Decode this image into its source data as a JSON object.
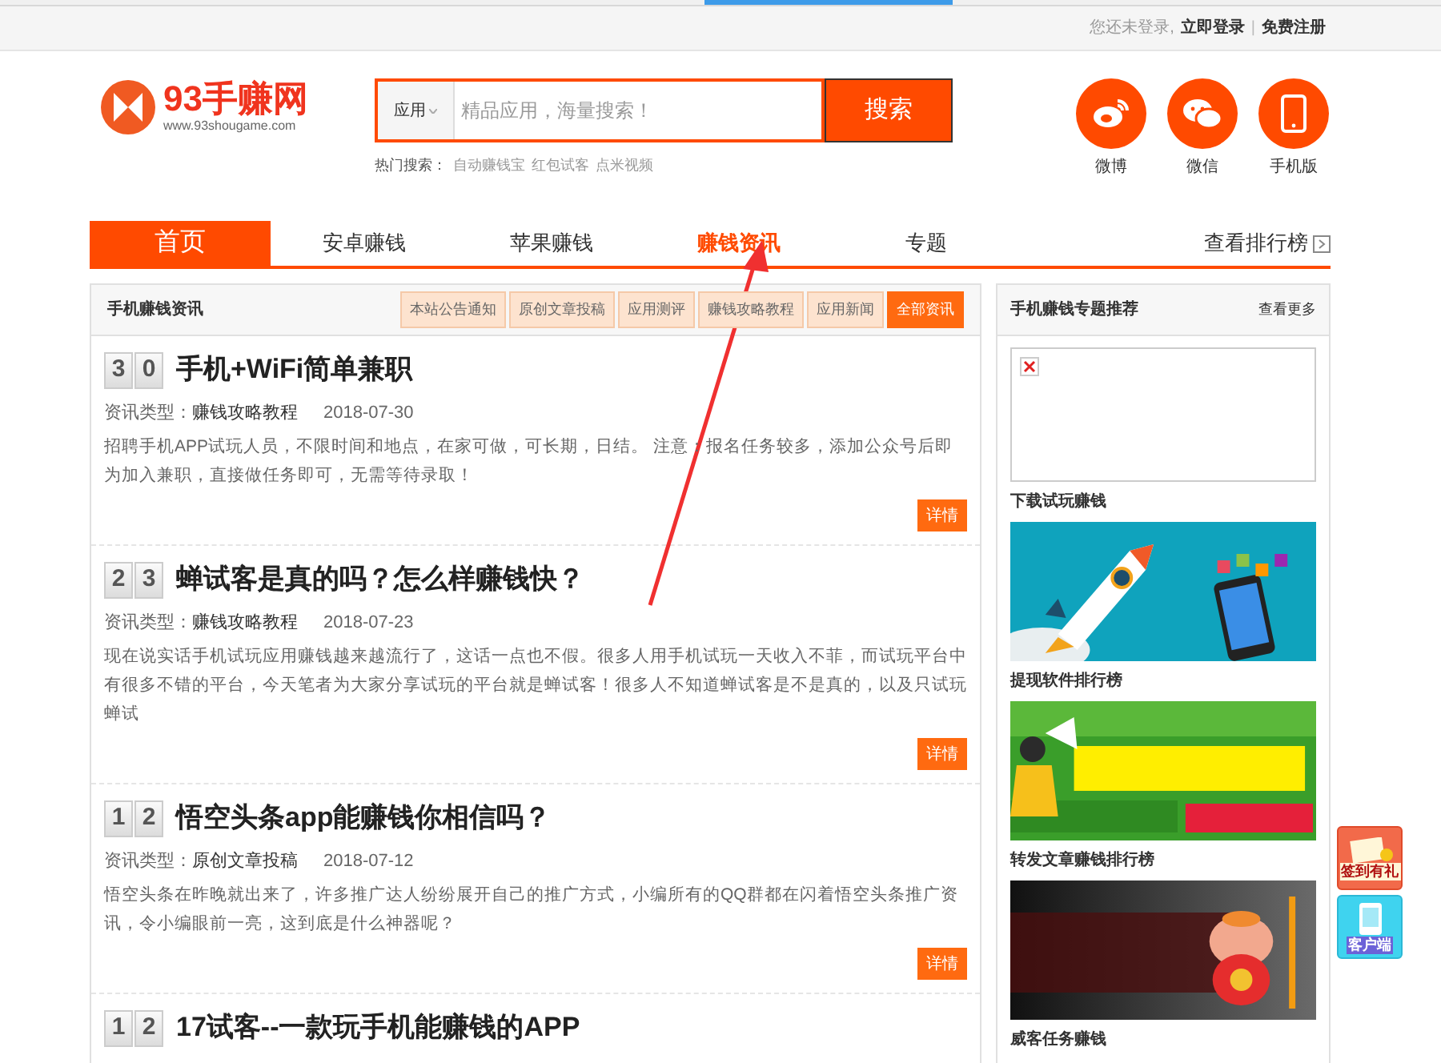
{
  "top_bar": {
    "notice": "您还未登录,",
    "login": "立即登录",
    "separator": "|",
    "register": "免费注册"
  },
  "logo": {
    "name": "93手赚网",
    "url": "www.93shougame.com"
  },
  "search": {
    "category": "应用",
    "placeholder": "精品应用，海量搜索！",
    "button": "搜索"
  },
  "hot_searches": {
    "label": "热门搜索：",
    "items": [
      "自动赚钱宝",
      "红包试客",
      "点米视频"
    ]
  },
  "social": [
    {
      "kind": "weibo",
      "label": "微博"
    },
    {
      "kind": "wechat",
      "label": "微信"
    },
    {
      "kind": "phone",
      "label": "手机版"
    }
  ],
  "nav": {
    "items": [
      {
        "label": "首页",
        "kind": "home",
        "selected": false
      },
      {
        "label": "安卓赚钱",
        "kind": "link",
        "selected": false
      },
      {
        "label": "苹果赚钱",
        "kind": "link",
        "selected": false
      },
      {
        "label": "赚钱资讯",
        "kind": "link",
        "selected": true
      },
      {
        "label": "专题",
        "kind": "link",
        "selected": false
      }
    ],
    "ranking": "查看排行榜"
  },
  "news": {
    "title": "手机赚钱资讯",
    "filters": [
      {
        "label": "本站公告通知",
        "selected": false
      },
      {
        "label": "原创文章投稿",
        "selected": false
      },
      {
        "label": "应用测评",
        "selected": false
      },
      {
        "label": "赚钱攻略教程",
        "selected": false
      },
      {
        "label": "应用新闻",
        "selected": false
      },
      {
        "label": "全部资讯",
        "selected": true
      }
    ],
    "articles": [
      {
        "digits": [
          "3",
          "0"
        ],
        "title": "手机+WiFi简单兼职",
        "type_label": "资讯类型：",
        "type": "赚钱攻略教程",
        "date": "2018-07-30",
        "summary": "招聘手机APP试玩人员，不限时间和地点，在家可做，可长期，日结。 注意：报名任务较多，添加公众号后即为加入兼职，直接做任务即可，无需等待录取！",
        "button": "详情"
      },
      {
        "digits": [
          "2",
          "3"
        ],
        "title": "蝉试客是真的吗？怎么样赚钱快？",
        "type_label": "资讯类型：",
        "type": "赚钱攻略教程",
        "date": "2018-07-23",
        "summary": "现在说实话手机试玩应用赚钱越来越流行了，这话一点也不假。很多人用手机试玩一天收入不菲，而试玩平台中有很多不错的平台，今天笔者为大家分享试玩的平台就是蝉试客！很多人不知道蝉试客是不是真的，以及只试玩蝉试",
        "button": "详情"
      },
      {
        "digits": [
          "1",
          "2"
        ],
        "title": "悟空头条app能赚钱你相信吗？",
        "type_label": "资讯类型：",
        "type": "原创文章投稿",
        "date": "2018-07-12",
        "summary": "悟空头条在昨晚就出来了，许多推广达人纷纷展开自己的推广方式，小编所有的QQ群都在闪着悟空头条推广资讯，令小编眼前一亮，这到底是什么神器呢？",
        "button": "详情"
      },
      {
        "digits": [
          "1",
          "2"
        ],
        "title": "17试客--一款玩手机能赚钱的APP"
      }
    ]
  },
  "sidebar": {
    "title": "手机赚钱专题推荐",
    "more": "查看更多",
    "items": [
      {
        "kind": "broken",
        "caption": "下载试玩赚钱"
      },
      {
        "kind": "rocket",
        "caption": "提现软件排行榜"
      },
      {
        "kind": "green",
        "caption": "转发文章赚钱排行榜"
      },
      {
        "kind": "dark",
        "caption": "威客任务赚钱"
      }
    ]
  },
  "floating": [
    {
      "kind": "gift",
      "label": "签到有礼"
    },
    {
      "kind": "client",
      "label": "客户端"
    }
  ]
}
